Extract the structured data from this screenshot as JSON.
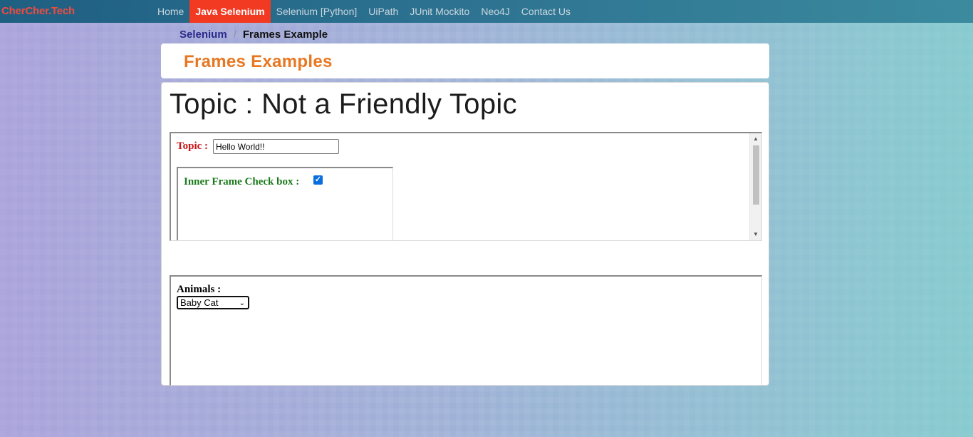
{
  "navbar": {
    "brand": "CherCher.Tech",
    "items": [
      {
        "label": "Home",
        "active": false
      },
      {
        "label": "Java Selenium",
        "active": true
      },
      {
        "label": "Selenium [Python]",
        "active": false
      },
      {
        "label": "UiPath",
        "active": false
      },
      {
        "label": "JUnit Mockito",
        "active": false
      },
      {
        "label": "Neo4J",
        "active": false
      },
      {
        "label": "Contact Us",
        "active": false
      }
    ]
  },
  "breadcrumb": {
    "link": "Selenium",
    "separator": "/",
    "current": "Frames Example"
  },
  "header": {
    "title": "Frames Examples"
  },
  "main": {
    "heading": "Topic : Not a Friendly Topic",
    "frame1": {
      "topic_label": "Topic :",
      "topic_value": "Hello World!!",
      "inner_frame": {
        "checkbox_label": "Inner Frame Check box :",
        "checked": true
      }
    },
    "frame2": {
      "animals_label": "Animals :",
      "selected": "Baby Cat"
    }
  },
  "colors": {
    "brand": "#ef4b3f",
    "active_nav": "#f23a22",
    "header_title": "#e87722",
    "topic_label": "#cc1111",
    "inner_label": "#1a7a1a"
  }
}
